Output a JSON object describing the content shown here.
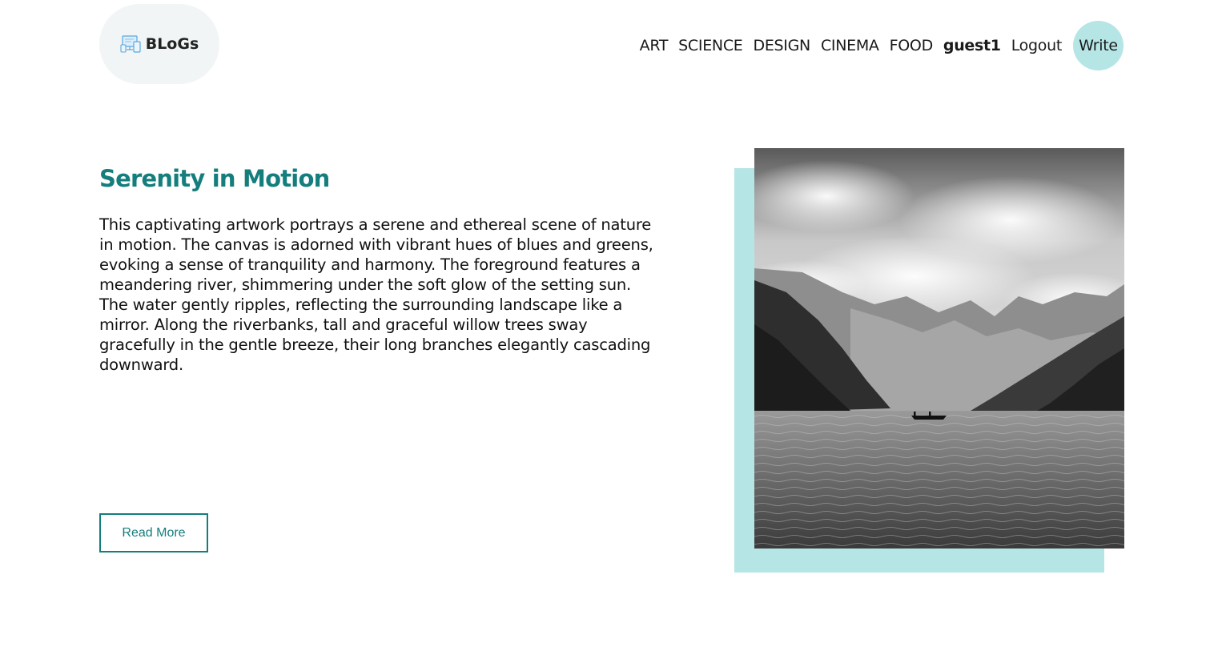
{
  "header": {
    "logo": {
      "text": "BLoGs",
      "icon": "monitor-devices-icon"
    },
    "nav": {
      "items": [
        "ART",
        "SCIENCE",
        "DESIGN",
        "CINEMA",
        "FOOD"
      ],
      "username": "guest1",
      "logout_label": "Logout",
      "write_label": "Write"
    }
  },
  "post": {
    "title": "Serenity in Motion",
    "description": "This captivating artwork portrays a serene and ethereal scene of nature in motion. The canvas is adorned with vibrant hues of blues and greens, evoking a sense of tranquility and harmony. The foreground features a meandering river, shimmering under the soft glow of the setting sun. The water gently ripples, reflecting the surrounding landscape like a mirror. Along the riverbanks, tall and graceful willow trees sway gracefully in the gentle breeze, their long branches elegantly cascading downward.",
    "read_more_label": "Read More",
    "image_subject": "mountain-lake-boat-photo"
  },
  "colors": {
    "accent": "#147e7d",
    "highlight": "#b6e5e6",
    "logo_bg": "#f2f5f5"
  }
}
